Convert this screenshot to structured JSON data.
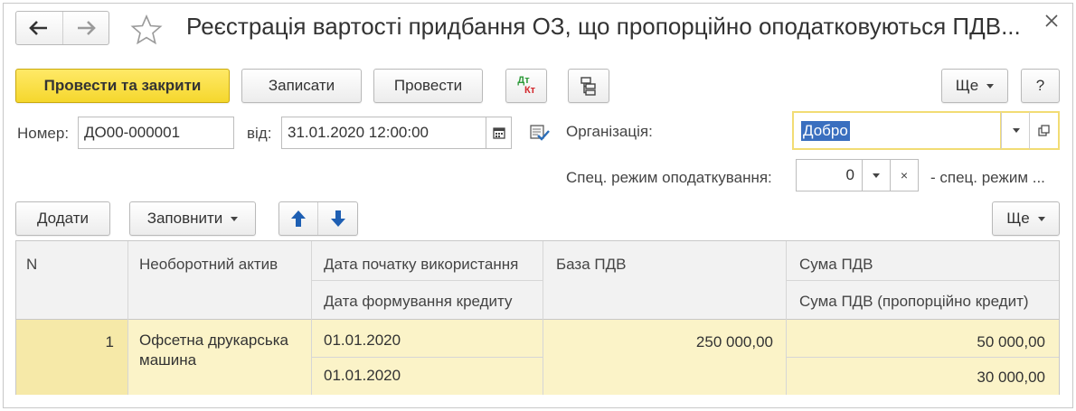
{
  "header": {
    "title": "Реєстрація вартості придбання ОЗ, що пропорційно оподатковуються ПДВ..."
  },
  "toolbar": {
    "post_close_label": "Провести та закрити",
    "save_label": "Записати",
    "post_label": "Провести",
    "dt_label": "Дт",
    "kt_label": "Кт",
    "more_label": "Ще",
    "help_label": "?"
  },
  "form": {
    "number_label": "Номер:",
    "number_value": "ДО00-000001",
    "date_label": "від:",
    "date_value": "31.01.2020 12:00:00",
    "org_label": "Організація:",
    "org_value": "Добро",
    "spec_label": "Спец. режим оподаткування:",
    "spec_value": "0",
    "spec_note": "- спец. режим ..."
  },
  "table_toolbar": {
    "add_label": "Додати",
    "fill_label": "Заповнити",
    "more_label": "Ще"
  },
  "table": {
    "headers": {
      "n": "N",
      "asset": "Необоротний актив",
      "date_start": "Дата початку використання",
      "date_credit": "Дата формування кредиту",
      "vat_base": "База ПДВ",
      "vat_sum": "Сума ПДВ",
      "vat_sum_prop": "Сума ПДВ (пропорційно кредит)"
    },
    "rows": [
      {
        "n": "1",
        "asset_line1": "Офсетна друкарська",
        "asset_line2": "машина",
        "date_start": "01.01.2020",
        "date_credit": "01.01.2020",
        "vat_base": "250 000,00",
        "vat_sum": "50 000,00",
        "vat_sum_prop": "30 000,00"
      }
    ]
  },
  "colors": {
    "primary_button": "#f5d72d",
    "row_highlight": "#fbf3c8",
    "selection": "#3a6fbf",
    "arrow_blue": "#1e5fb3"
  }
}
